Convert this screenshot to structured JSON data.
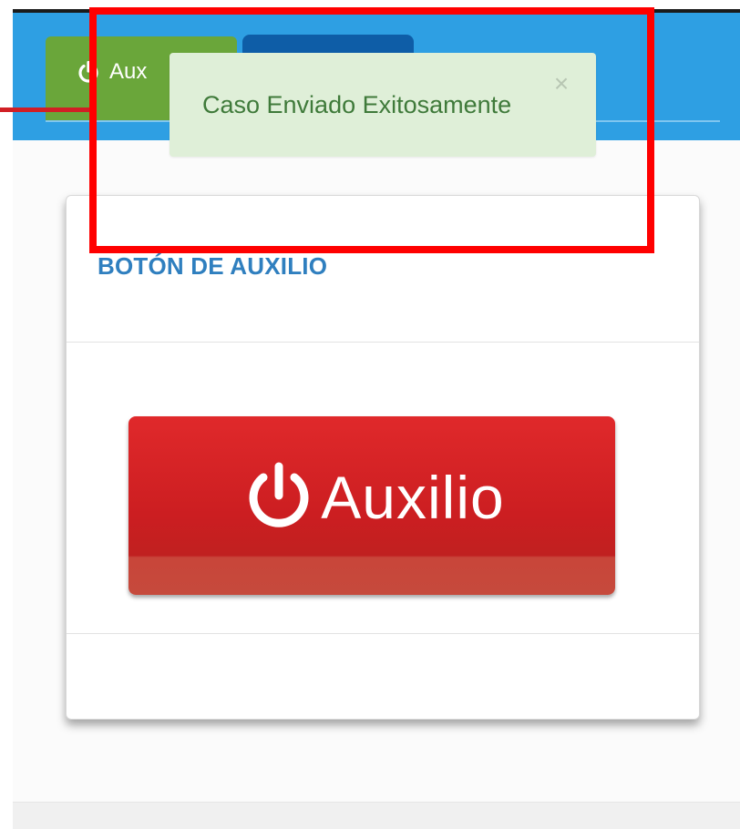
{
  "tabs": [
    {
      "label": "Aux",
      "icon": "power-icon",
      "color": "#6aa63a"
    },
    {
      "label": "",
      "color": "#0e5da7"
    }
  ],
  "toast": {
    "message": "Caso Enviado Exitosamente",
    "close_symbol": "×"
  },
  "card": {
    "title": "BOTÓN DE AUXILIO",
    "button_label": "Auxilio",
    "button_icon": "power-icon"
  },
  "colors": {
    "appbar": "#2e9fe3",
    "accent_red": "#d7262a",
    "title_blue": "#2f7fbf",
    "toast_bg": "#dfefd8",
    "toast_text": "#3f7a3a",
    "highlight": "#ff0000"
  }
}
